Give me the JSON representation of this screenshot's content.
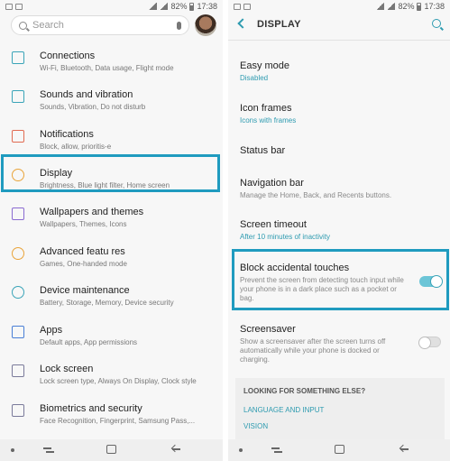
{
  "left": {
    "status": {
      "battery": "82%",
      "time": "17:38"
    },
    "search_placeholder": "Search",
    "items": [
      {
        "title": "Connections",
        "subtitle": "Wi-Fi, Bluetooth, Data usage, Flight mode",
        "icon": "connections-icon"
      },
      {
        "title": "Sounds and vibration",
        "subtitle": "Sounds, Vibration, Do not disturb",
        "icon": "sound-icon"
      },
      {
        "title": "Notifications",
        "subtitle": "Block, allow, prioritis-e",
        "icon": "notifications-icon"
      },
      {
        "title": "Display",
        "subtitle": "Brightness, Blue light filter, Home screen",
        "icon": "display-icon"
      },
      {
        "title": "Wallpapers and  themes",
        "subtitle": "Wallpapers, Themes, Icons",
        "icon": "brush-icon"
      },
      {
        "title": "Advanced featu res",
        "subtitle": "Games, One-handed  mode",
        "icon": "gear-icon"
      },
      {
        "title": "Device maintenance",
        "subtitle": "Battery, Storage, Memory, Device security",
        "icon": "maintenance-icon"
      },
      {
        "title": "Apps",
        "subtitle": "Default apps, App permissions",
        "icon": "apps-icon"
      },
      {
        "title": "Lock screen",
        "subtitle": "Lock screen type, Always On Display, Clock style",
        "icon": "lock-icon"
      },
      {
        "title": "Biometrics and  security",
        "subtitle": "Face Recognition, Fingerprint, Samsung Pass,...",
        "icon": "shield-icon"
      }
    ]
  },
  "right": {
    "status": {
      "battery": "82%",
      "time": "17:38"
    },
    "title": "DISPLAY",
    "items": [
      {
        "title": "Easy mode",
        "subtitle": "Disabled",
        "style": "teal"
      },
      {
        "title": "Icon frames",
        "subtitle": "Icons with frames",
        "style": "teal"
      },
      {
        "title": "Status bar",
        "subtitle": "",
        "style": "teal"
      },
      {
        "title": "Navigation bar",
        "subtitle": "Manage the Home, Back, and Recents buttons.",
        "style": "gray"
      },
      {
        "title": "Screen timeout",
        "subtitle": "After 10 minutes of inactivity",
        "style": "teal"
      },
      {
        "title": "Block accidental touches",
        "subtitle": "Prevent the screen from detecting touch input while your phone is in a dark place such as a pocket or bag.",
        "style": "gray",
        "toggle": true
      },
      {
        "title": "Screensaver",
        "subtitle": "Show a screensaver after the screen turns off automatically while your phone is docked or charging.",
        "style": "gray",
        "toggle": false
      }
    ],
    "card": {
      "heading": "LOOKING FOR SOMETHING ELSE?",
      "links": [
        "LANGUAGE AND INPUT",
        "VISION"
      ]
    }
  },
  "colors": {
    "accent": "#2e9bb0",
    "highlight": "#1f9bbf",
    "toggle_on": "#6cc5d7"
  }
}
